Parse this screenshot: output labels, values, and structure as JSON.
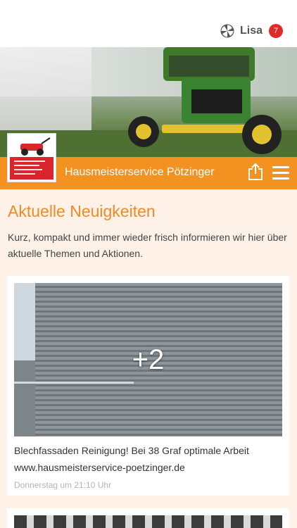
{
  "header": {
    "user_name": "Lisa",
    "notification_count": "7",
    "user_logo_icon": "pinwheel-logo-icon"
  },
  "brand": {
    "name": "Hausmeisterservice Pötzinger",
    "share_icon": "share-icon",
    "menu_icon": "hamburger-menu-icon",
    "accent": "#f39121"
  },
  "section": {
    "title": "Aktuelle Neuigkeiten",
    "intro": "Kurz, kompakt und immer wieder frisch informieren wir hier über aktuelle Themen und Aktionen."
  },
  "posts": [
    {
      "more_images": "+2",
      "title": "Blechfassaden Reinigung! Bei 38 Graf optimale Arbeit",
      "link": "www.hausmeisterservice-poetzinger.de",
      "date": "Donnerstag um 21:10 Uhr"
    }
  ]
}
